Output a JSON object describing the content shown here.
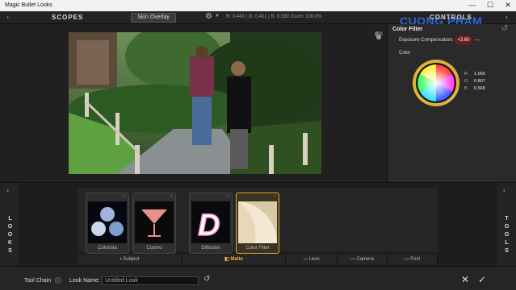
{
  "window": {
    "title": "Magic Bullet Looks",
    "minimize": "—",
    "maximize": "☐",
    "close": "✕"
  },
  "toolbar": {
    "scopes": "SCOPES",
    "skin_overlay": "Skin Overlay",
    "readout": "R: 0.443 | G: 0.401 | B: 0.339   Zoom: 100.0%",
    "controls": "CONTROLS",
    "watermark": "CUONG PHAM"
  },
  "controls": {
    "title": "Color Filter",
    "exposure_label": "Exposure Compensation:",
    "exposure_value": "+3.60",
    "color_label": "Color",
    "r_label": "R",
    "r_value": "1.000",
    "g_label": "G",
    "g_value": "0.807",
    "b_label": "B",
    "b_value": "0.568"
  },
  "looks": {
    "left_tab": "LOOKS",
    "right_tab": "TOOLS",
    "tools": [
      {
        "name": "Colorista"
      },
      {
        "name": "Cosmo"
      },
      {
        "name": "Diffusion"
      },
      {
        "name": "Color Filter"
      }
    ],
    "categories": [
      {
        "label": "Subject"
      },
      {
        "label": "Matte"
      },
      {
        "label": "Lens"
      },
      {
        "label": "Camera"
      },
      {
        "label": "Post"
      }
    ]
  },
  "bottom": {
    "tool_chain": "Tool Chain",
    "look_name_label": "Look Name:",
    "look_name_value": "Untitled Look"
  }
}
